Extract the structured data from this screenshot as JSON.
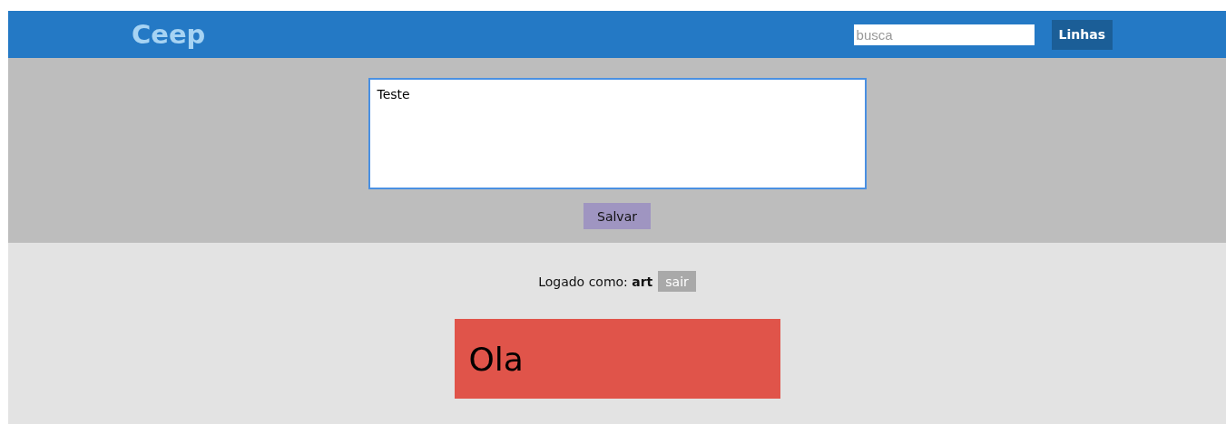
{
  "header": {
    "logo": "Ceep",
    "search": {
      "placeholder": "busca"
    },
    "layout_button": "Linhas"
  },
  "form": {
    "note_text": "Teste",
    "save_button": "Salvar"
  },
  "session": {
    "text": "Logado como: **art**",
    "logout_button": "sair"
  },
  "notes": [
    {
      "text": "Ola",
      "color": "#e0544a"
    }
  ]
}
